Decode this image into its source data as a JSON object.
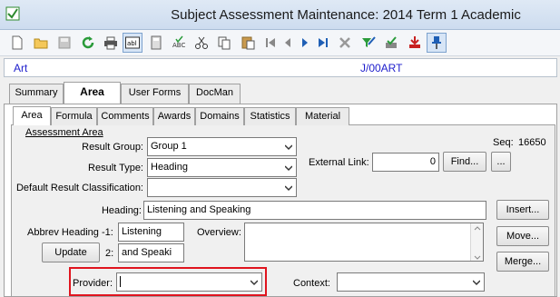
{
  "window": {
    "title": "Subject Assessment Maintenance:  2014 Term 1 Academic"
  },
  "toolbar": {
    "buttons": [
      "new-icon",
      "open-icon",
      "save-icon",
      "refresh-icon",
      "print-icon",
      "text-field-icon",
      "calculator-icon",
      "spellcheck-icon",
      "cut-icon",
      "copy-icon",
      "paste-icon",
      "first-record-icon",
      "previous-record-icon",
      "next-record-icon",
      "last-record-icon",
      "delete-icon",
      "filter-icon",
      "approve-icon",
      "import-icon",
      "pin-icon"
    ]
  },
  "header": {
    "subject": "Art",
    "code": "J/00ART"
  },
  "tabs_main": [
    "Summary",
    "Area",
    "User Forms",
    "DocMan"
  ],
  "tabs_main_selected": "Area",
  "tabs_sub": [
    "Area",
    "Formula",
    "Comments",
    "Awards",
    "Domains",
    "Statistics",
    "Material"
  ],
  "tabs_sub_selected": "Area",
  "section": {
    "title": "Assessment Area",
    "seq_label": "Seq:",
    "seq_value": "16650"
  },
  "form": {
    "result_group_label": "Result Group:",
    "result_group_value": "Group 1",
    "result_type_label": "Result Type:",
    "result_type_value": "Heading",
    "default_classification_label": "Default Result Classification:",
    "default_classification_value": "",
    "external_link_label": "External Link:",
    "external_link_value": "0",
    "find_button": "Find...",
    "ellipsis_button": "...",
    "heading_label": "Heading:",
    "heading_value": "Listening and Speaking",
    "insert_button": "Insert...",
    "abbrev_label": "Abbrev Heading -1:",
    "abbrev_value_1": "Listening",
    "abbrev_2_label": "2:",
    "abbrev_value_2": "and Speaki",
    "update_button": "Update",
    "overview_label": "Overview:",
    "overview_value": "",
    "move_button": "Move...",
    "merge_button": "Merge...",
    "provider_label": "Provider:",
    "provider_value": "",
    "context_label": "Context:",
    "context_value": ""
  },
  "colors": {
    "highlight": "#e0141e",
    "link_blue": "#1d1dcc"
  }
}
